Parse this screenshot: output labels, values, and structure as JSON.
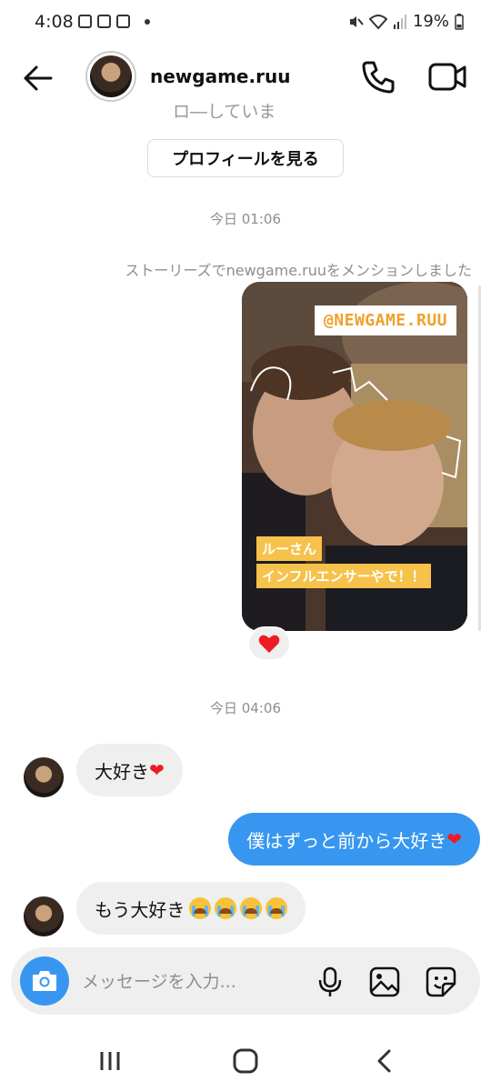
{
  "status": {
    "time": "4:08",
    "battery": "19%"
  },
  "header": {
    "username": "newgame.ruu"
  },
  "chat": {
    "cut_off_text": "ロ―していま",
    "profile_button": "プロフィールを見る",
    "timestamp_1": "今日 01:06",
    "mention_text": "ストーリーズでnewgame.ruuをメンションしました",
    "story": {
      "tag": "@NEWGAME.RUU",
      "caption_1": "ルーさん",
      "caption_2": "インフルエンサーやで！！"
    },
    "reaction": "❤️",
    "timestamp_2": "今日 04:06",
    "messages": [
      {
        "text": "大好き",
        "heart": "❤"
      },
      {
        "text": "僕はずっと前から大好き",
        "heart": "❤"
      },
      {
        "text": "もう大好き"
      }
    ]
  },
  "composer": {
    "placeholder": "メッセージを入力..."
  },
  "colors": {
    "accent": "#3797f0",
    "heart": "#ed1c24",
    "bubble_in": "#efefef"
  },
  "icons": [
    "back-arrow-icon",
    "phone-icon",
    "video-icon",
    "camera-icon",
    "mic-icon",
    "gallery-icon",
    "sticker-icon"
  ]
}
